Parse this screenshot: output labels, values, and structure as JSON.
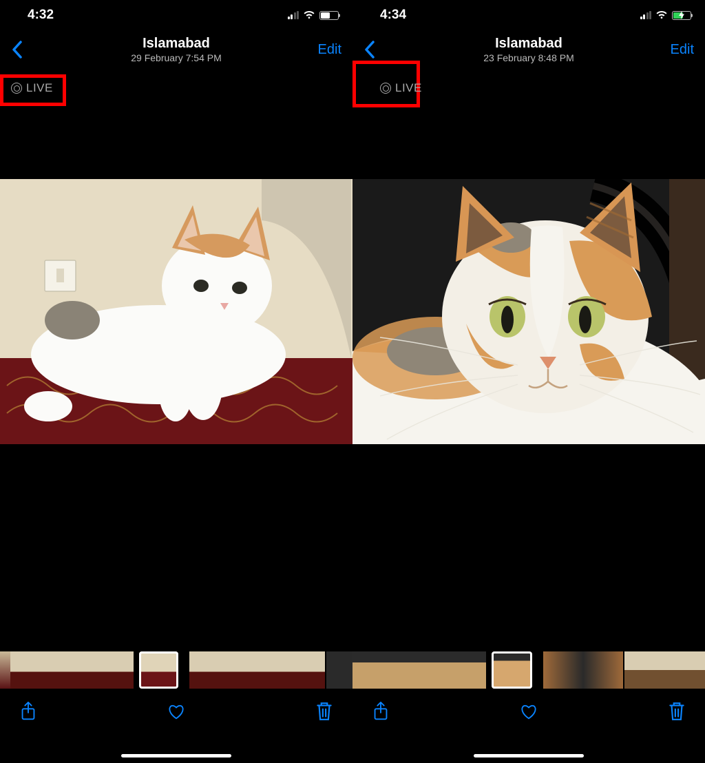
{
  "accent_color": "#0a84ff",
  "annotation_color": "#ff0000",
  "screens": [
    {
      "status": {
        "time": "4:32",
        "battery_charging": false
      },
      "header": {
        "back": true,
        "title": "Islamabad",
        "subtitle": "29 February  7:54 PM",
        "edit_label": "Edit"
      },
      "live_badge": {
        "label": "LIVE",
        "highlighted": true
      },
      "toolbar": {
        "share": "share-icon",
        "favorite": "heart-icon",
        "delete": "trash-icon"
      }
    },
    {
      "status": {
        "time": "4:34",
        "battery_charging": true
      },
      "header": {
        "back": true,
        "title": "Islamabad",
        "subtitle": "23 February  8:48 PM",
        "edit_label": "Edit"
      },
      "live_badge": {
        "label": "LIVE",
        "highlighted": true
      },
      "toolbar": {
        "share": "share-icon",
        "favorite": "heart-icon",
        "delete": "trash-icon"
      }
    }
  ]
}
